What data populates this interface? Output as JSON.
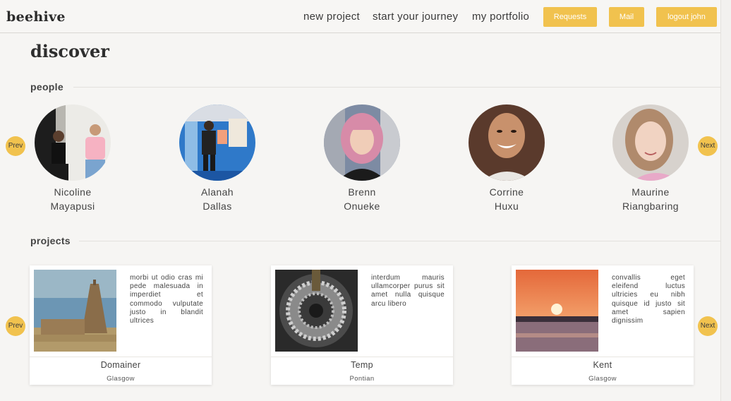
{
  "brand": "beehive",
  "nav": {
    "links": [
      "new project",
      "start your journey",
      "my portfolio"
    ],
    "buttons": [
      "Requests",
      "Mail",
      "logout john"
    ]
  },
  "page_title": "discover",
  "people_section": {
    "title": "people",
    "prev": "Prev",
    "next": "Next",
    "people": [
      {
        "first": "Nicoline",
        "last": "Mayapusi"
      },
      {
        "first": "Alanah",
        "last": "Dallas"
      },
      {
        "first": "Brenn",
        "last": "Onueke"
      },
      {
        "first": "Corrine",
        "last": "Huxu"
      },
      {
        "first": "Maurine",
        "last": "Riangbaring"
      }
    ]
  },
  "projects_section": {
    "title": "projects",
    "prev": "Prev",
    "next": "Next",
    "projects": [
      {
        "title": "Domainer",
        "location": "Glasgow",
        "description": "morbi ut odio cras mi pede malesuada in imperdiet et commodo vulputate justo in blandit ultrices"
      },
      {
        "title": "Temp",
        "location": "Pontian",
        "description": "interdum mauris ullamcorper purus sit amet nulla quisque arcu libero"
      },
      {
        "title": "Kent",
        "location": "Glasgow",
        "description": "convallis eget eleifend luctus ultricies eu nibh quisque id justo sit amet sapien dignissim"
      }
    ]
  },
  "colors": {
    "accent": "#f1c24e",
    "background": "#f6f5f3"
  }
}
